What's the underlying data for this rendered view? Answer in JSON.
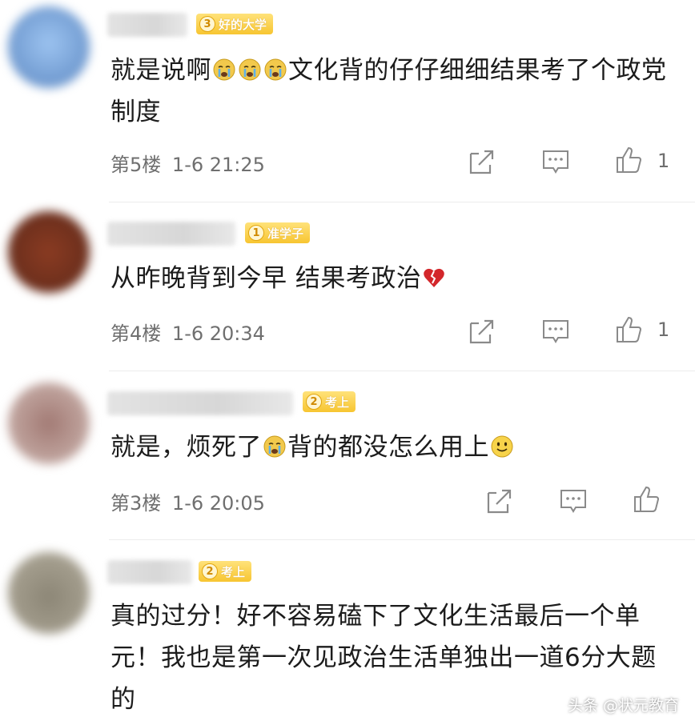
{
  "comments": [
    {
      "badge_level": "3",
      "badge_title": "好的大学",
      "content_parts": [
        "就是说啊",
        "文化背的仔仔细细结果考了个政党制度"
      ],
      "floor": "第5楼",
      "time": "1-6 21:25",
      "likes": "1",
      "avatar_color": "#8fb6e6"
    },
    {
      "badge_level": "1",
      "badge_title": "准学子",
      "content_parts": [
        "从昨晚背到今早  结果考政治"
      ],
      "floor": "第4楼",
      "time": "1-6 20:34",
      "likes": "1",
      "avatar_color": "#7a3a22"
    },
    {
      "badge_level": "2",
      "badge_title": "考上",
      "content_parts": [
        "就是，烦死了",
        "背的都没怎么用上"
      ],
      "floor": "第3楼",
      "time": "1-6 20:05",
      "likes": "",
      "avatar_color": "#a9817b"
    },
    {
      "badge_level": "2",
      "badge_title": "考上",
      "content_parts": [
        "真的过分！好不容易磕下了文化生活最后一个单元！我也是第一次见政治生活单独出一道6分大题的"
      ],
      "avatar_color": "#8e8a80"
    }
  ],
  "icons": {
    "share": "share-icon",
    "reply": "comment-icon",
    "like": "thumbs-up-icon",
    "crying": "crying-face-emoji",
    "broken_heart": "broken-heart-emoji",
    "smile": "smile-emoji"
  },
  "watermark": "头条 @状元教育"
}
